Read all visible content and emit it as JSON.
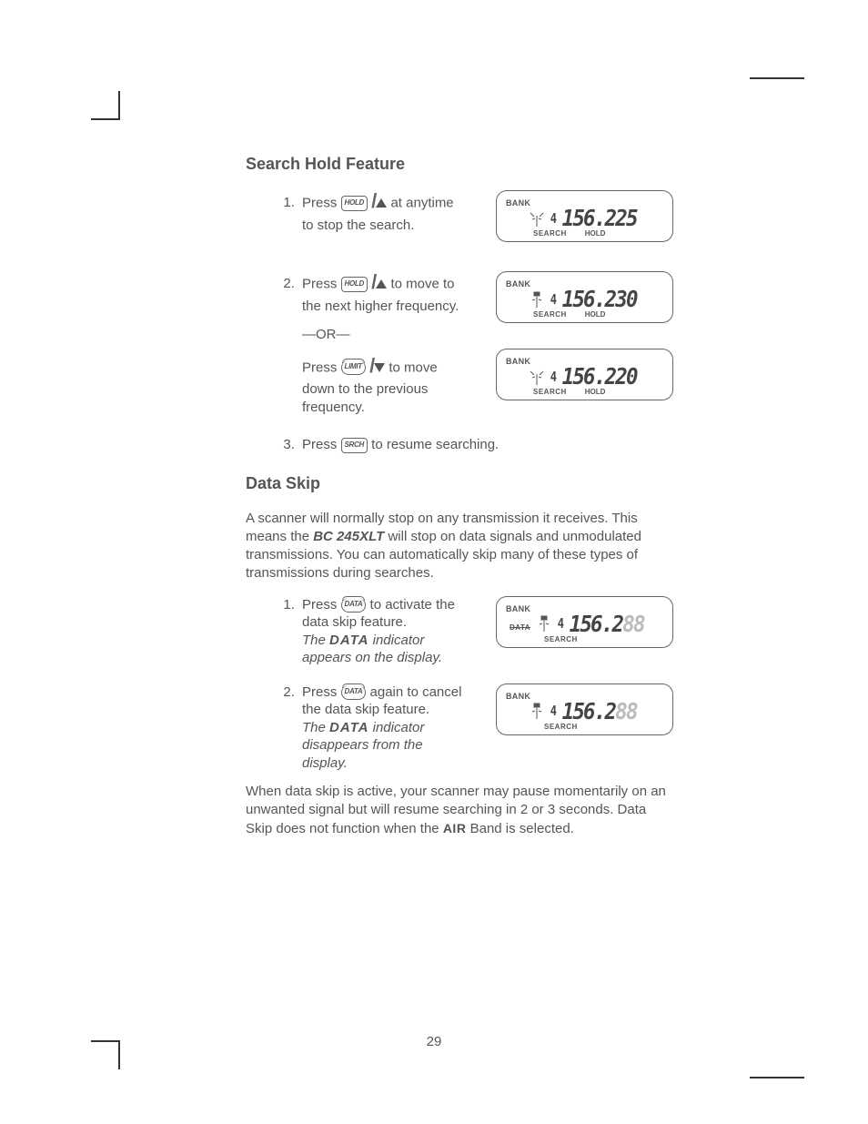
{
  "page_number": "29",
  "section1": {
    "title": "Search Hold Feature",
    "steps": [
      {
        "pre": "Press",
        "key": "HOLD",
        "post": "at anytime to stop the search.",
        "arrow": "up",
        "lcd": {
          "bank": "BANK",
          "small": "4",
          "freq": "156.225",
          "bottom": [
            "SEARCH",
            "HOLD"
          ],
          "data": false
        }
      },
      {
        "pre": "Press",
        "key": "HOLD",
        "post": "to move to the next higher frequency.",
        "arrow": "up",
        "or": "—OR—",
        "alt_pre": "Press",
        "alt_key": "LIMIT",
        "alt_arrow": "down",
        "alt_post": "to move down to the previous frequency.",
        "lcd1": {
          "bank": "BANK",
          "small": "4",
          "freq": "156.230",
          "bottom": [
            "SEARCH",
            "HOLD"
          ],
          "data": false
        },
        "lcd2": {
          "bank": "BANK",
          "small": "4",
          "freq": "156.220",
          "bottom": [
            "SEARCH",
            "HOLD"
          ],
          "data": false
        }
      },
      {
        "pre": "Press",
        "key": "SRCH",
        "post": "to resume searching."
      }
    ]
  },
  "section2": {
    "title": "Data Skip",
    "intro_a": "A scanner will normally stop on any transmission it receives. This means the ",
    "product": "BC 245XLT",
    "intro_b": " will stop on data signals and unmodulated transmissions. You can automatically skip many of these types of transmissions during searches.",
    "steps": [
      {
        "pre": "Press",
        "key": "DATA",
        "post": "to activate the data skip feature.",
        "note_a": "The ",
        "note_word": "DATA",
        "note_b": " indicator appears on the display.",
        "lcd": {
          "bank": "BANK",
          "small": "4",
          "freq_bold": "156.2",
          "freq_faint": "88",
          "bottom": [
            "SEARCH"
          ],
          "data": true,
          "data_label": "DATA"
        }
      },
      {
        "pre": "Press",
        "key": "DATA",
        "post": "again to cancel the data skip feature.",
        "note_a": "The ",
        "note_word": "DATA",
        "note_b": " indicator disappears from the display.",
        "lcd": {
          "bank": "BANK",
          "small": "4",
          "freq_bold": "156.2",
          "freq_faint": "88",
          "bottom": [
            "SEARCH"
          ],
          "data": false
        }
      }
    ],
    "outro_a": "When data skip is active, your scanner may pause momentarily on an unwanted signal but will resume searching in 2 or 3 seconds. Data Skip does not function when the ",
    "air": "AIR",
    "outro_b": " Band is selected."
  }
}
